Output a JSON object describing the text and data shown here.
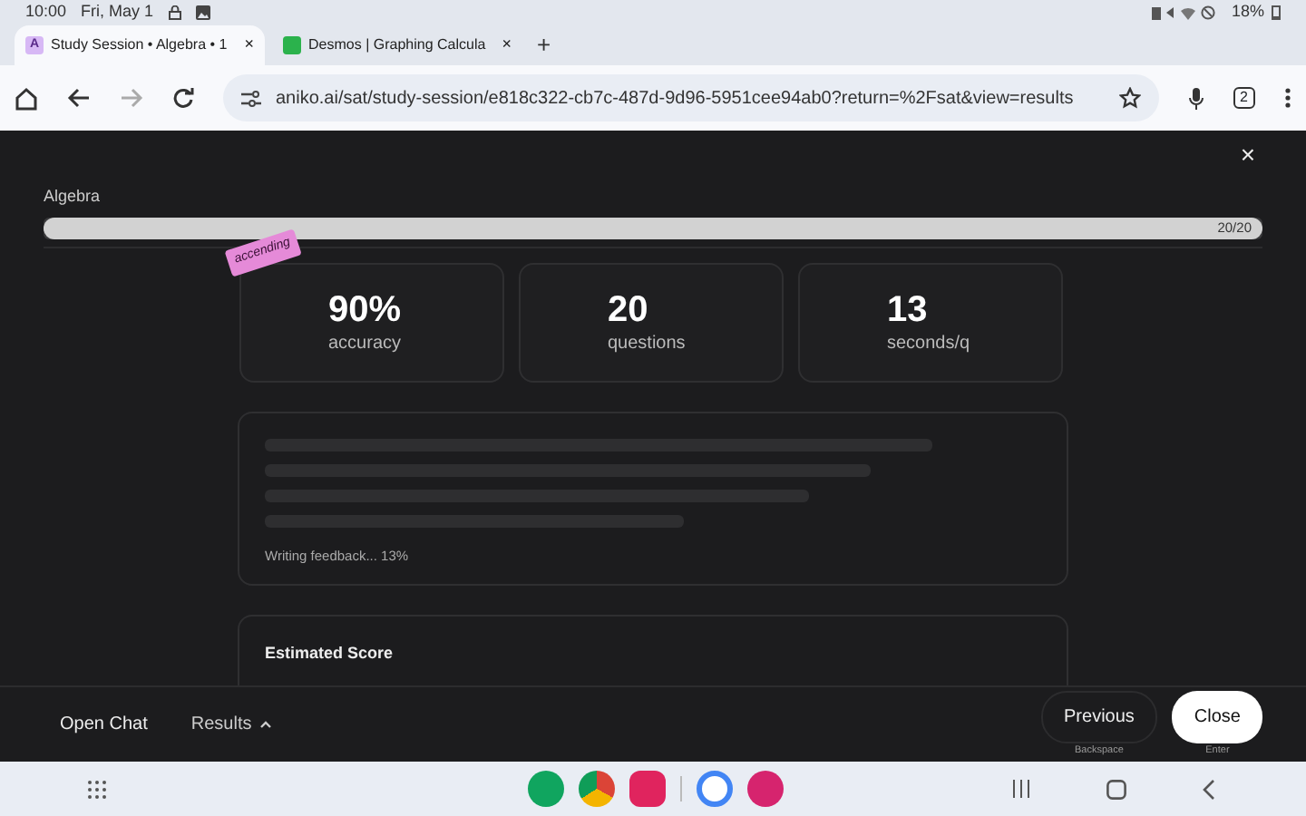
{
  "status_bar": {
    "time": "10:00",
    "date": "Fri, May 1",
    "battery": "18%"
  },
  "tabs": [
    {
      "title": "Study Session • Algebra • 1",
      "close": "×",
      "selected": true,
      "favicon": "A"
    },
    {
      "title": "Desmos | Graphing Calcula",
      "close": "×",
      "selected": false
    }
  ],
  "new_tab": "+",
  "address_bar": {
    "url": "aniko.ai/sat/study-session/e818c322-cb7c-487d-9d96-5951cee94ab0?return=%2Fsat&view=results",
    "tab_count": "2"
  },
  "dialog": {
    "close": "×",
    "subject": "Algebra",
    "progress": {
      "level": 1,
      "reading": "20/20"
    },
    "sticker": "accending",
    "stats": [
      {
        "value": "90%",
        "label": "accuracy"
      },
      {
        "value": "20",
        "label": "questions"
      },
      {
        "value": "13",
        "label": "seconds/q"
      }
    ],
    "feedback_status": "Writing feedback... 13%",
    "score_title": "Estimated Score"
  },
  "footer": {
    "open_chat": "Open Chat",
    "results": "Results",
    "previous": "Previous",
    "previous_hint": "Backspace",
    "close": "Close",
    "close_hint": "Enter"
  }
}
